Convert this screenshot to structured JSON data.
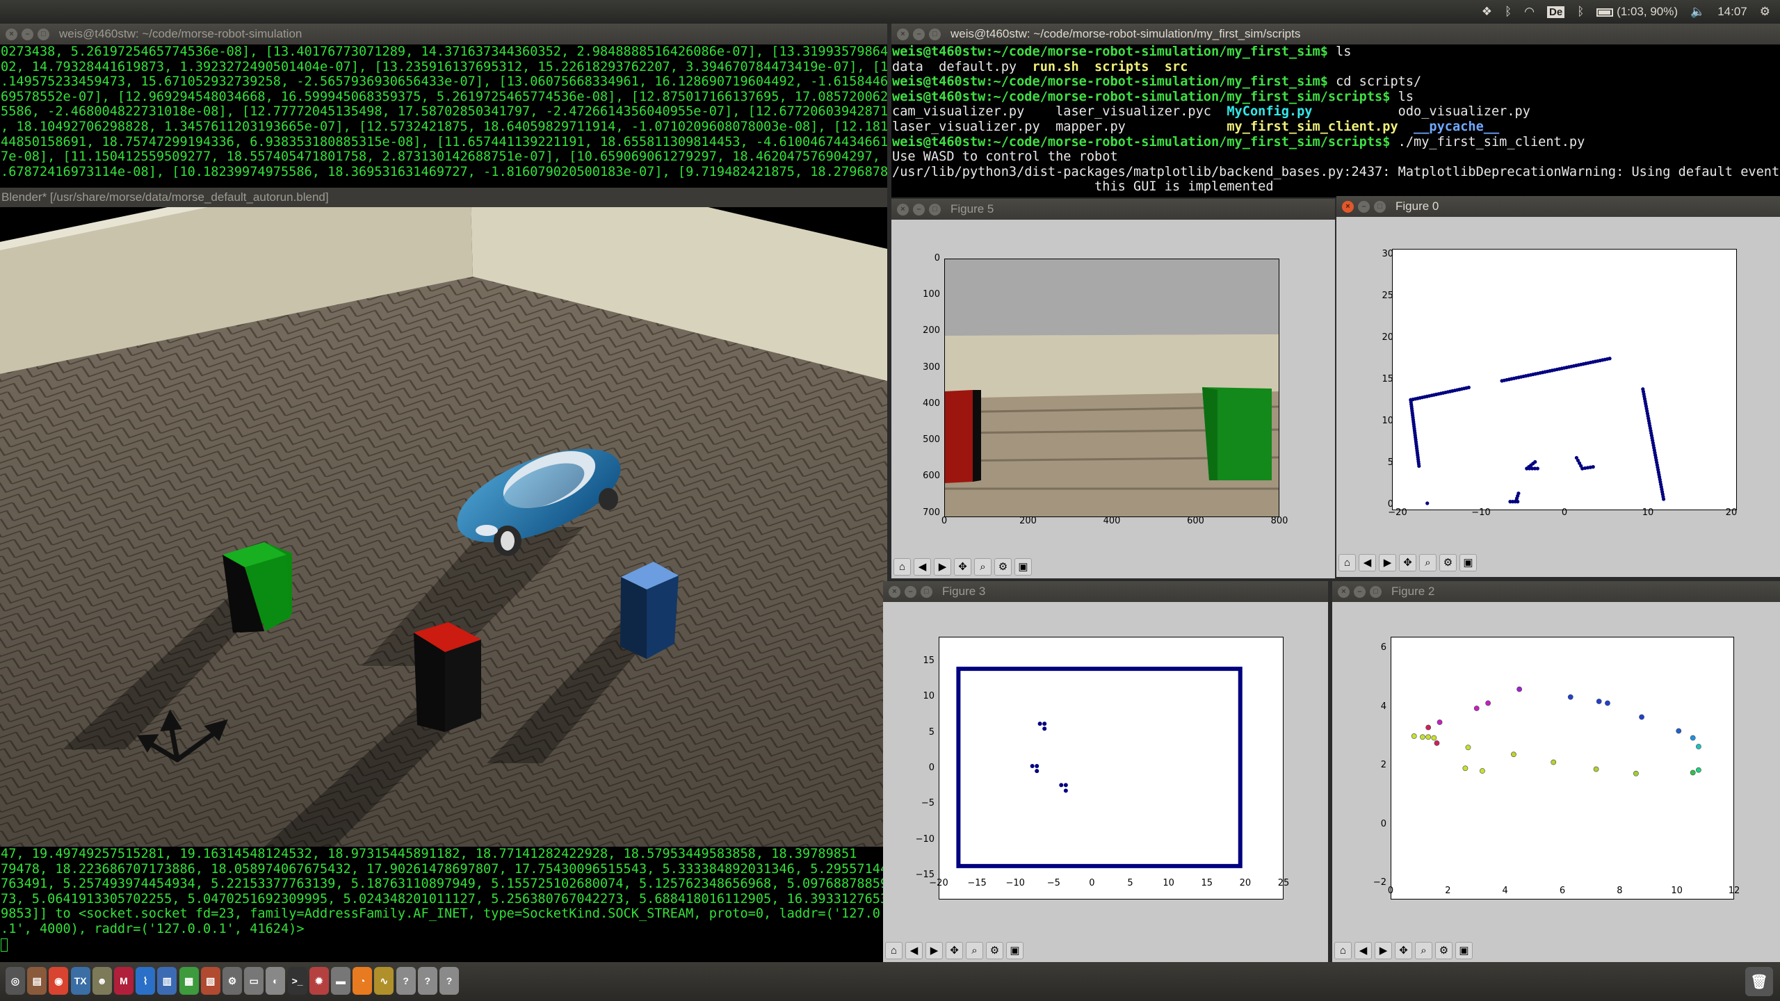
{
  "topbar": {
    "keyboard": "De",
    "battery": "(1:03, 90%)",
    "clock": "14:07"
  },
  "term1": {
    "title": "weis@t460stw: ~/code/morse-robot-simulation",
    "lines_top": [
      "0273438, 5.2619725465774536e-08], [13.40176773071289, 14.371637344360352, 2.9848888516426086e-07], [13.319935798645",
      "02, 14.79328441619873, 1.3923272490501404e-07], [13.235916137695312, 15.22618293762207, 3.394670784473419e-07], [13",
      ".149575233459473, 15.671052932739258, -2.5657936930656433e-07], [13.06075668334961, 16.128690719604492, -1.61584466",
      "69578552e-07], [12.969294548034668, 16.599945068359375, 5.2619725465774536e-08], [12.875017166137695, 17.0857200622",
      "5586, -2.468004822731018e-08], [12.77772045135498, 17.58702850341797, -2.4726614356040955e-07], [12.677206039428711",
      ", 18.10492706298828, 1.3457611203193665e-07], [12.5732421875, 18.64059829711914, -1.0710209608078003e-08], [12.1812",
      "44850158691, 18.75747299194336, 6.938353180885315e-08], [11.657441139221191, 18.655811309814453, -4.610046744346618",
      "7e-08], [11.150412559509277, 18.557405471801758, 2.873130142688751e-07], [10.659069061279297, 18.462047576904297, 3",
      ".67872416973114e-08], [10.18239974975586, 18.369531631469727, -1.816079020500183e-07], [9.719482421875, 18.27968788"
    ],
    "lines_bottom": [
      "47, 19.49749257515281, 19.16314548124532, 18.97315445891182, 18.77141282422928, 18.57953449583858, 18.39789851",
      "79478, 18.223686707173886, 18.058974067675432, 17.90261478697807, 17.75430096515543, 5.333384892031346, 5.295571445",
      "763491, 5.257493974454934, 5.22153377763139, 5.18763110897949, 5.155725102680074, 5.125762348656968, 5.097688788594",
      "73, 5.0641913305702255, 5.0470251692309995, 5.024348201011127, 5.256380767042273, 5.688418016112905, 16.393312765365",
      "9853]] to <socket.socket fd=23, family=AddressFamily.AF_INET, type=SocketKind.SOCK_STREAM, proto=0, laddr=('127.0.0",
      ".1', 4000), raddr=('127.0.0.1', 41624)>"
    ]
  },
  "term2": {
    "title": "weis@t460stw: ~/code/morse-robot-simulation/my_first_sim/scripts",
    "prompt1": "weis@t460stw:~/code/morse-robot-simulation/my_first_sim$",
    "cmd1": " ls",
    "ls1_a": "data  default.py  ",
    "ls1_b": "run.sh  scripts  src",
    "cmd2": " cd scripts/",
    "prompt2": "weis@t460stw:~/code/morse-robot-simulation/my_first_sim/scripts$",
    "cmd3": " ls",
    "ls2_r1_a": "cam_visualizer.py    laser_visualizer.pyc  ",
    "ls2_r1_b": "MyConfig.py",
    "ls2_r1_c": "           odo_visualizer.py",
    "ls2_r2_a": "laser_visualizer.py  mapper.py             ",
    "ls2_r2_b": "my_first_sim_client.py",
    "ls2_r2_c": "  __pycache__",
    "cmd4": " ./my_first_sim_client.py",
    "out1": "Use WASD to control the robot",
    "out2": "/usr/lib/python3/dist-packages/matplotlib/backend_bases.py:2437: MatplotlibDeprecationWarning: Using default event",
    "out3": "                          this GUI is implemented"
  },
  "blender": {
    "title": "Blender* [/usr/share/morse/data/morse_default_autorun.blend]"
  },
  "fig5": {
    "title": "Figure 5",
    "xticks": [
      "0",
      "200",
      "400",
      "600",
      "800"
    ],
    "yticks": [
      "0",
      "100",
      "200",
      "300",
      "400",
      "500",
      "600",
      "700"
    ]
  },
  "fig0": {
    "title": "Figure 0",
    "xticks": [
      "−20",
      "−10",
      "0",
      "10",
      "20"
    ],
    "yticks": [
      "30",
      "25",
      "20",
      "15",
      "10",
      "5",
      "0"
    ]
  },
  "fig3": {
    "title": "Figure 3",
    "xticks": [
      "−20",
      "−15",
      "−10",
      "−5",
      "0",
      "5",
      "10",
      "15",
      "20",
      "25"
    ],
    "yticks": [
      "15",
      "10",
      "5",
      "0",
      "−5",
      "−10",
      "−15"
    ]
  },
  "fig2": {
    "title": "Figure 2",
    "xticks": [
      "0",
      "2",
      "4",
      "6",
      "8",
      "10",
      "12"
    ],
    "yticks": [
      "6",
      "4",
      "2",
      "0",
      "−2"
    ]
  },
  "toolbar_icons": [
    "home-icon",
    "back-icon",
    "forward-icon",
    "pan-icon",
    "zoom-icon",
    "configure-icon",
    "save-icon"
  ],
  "dock": [
    "dash",
    "files",
    "chrome",
    "texstudio",
    "gimp",
    "mendeley",
    "monitor",
    "document-viewer",
    "calc",
    "pdf",
    "settings",
    "screenshot",
    "disk",
    "terminal",
    "network",
    "drive",
    "blender",
    "oscilloscope",
    "unknown",
    "unknown",
    "unknown"
  ],
  "colors": {
    "terminal_green": "#33e03a",
    "accent_close": "#e2582b",
    "plot_blue": "#000080"
  }
}
